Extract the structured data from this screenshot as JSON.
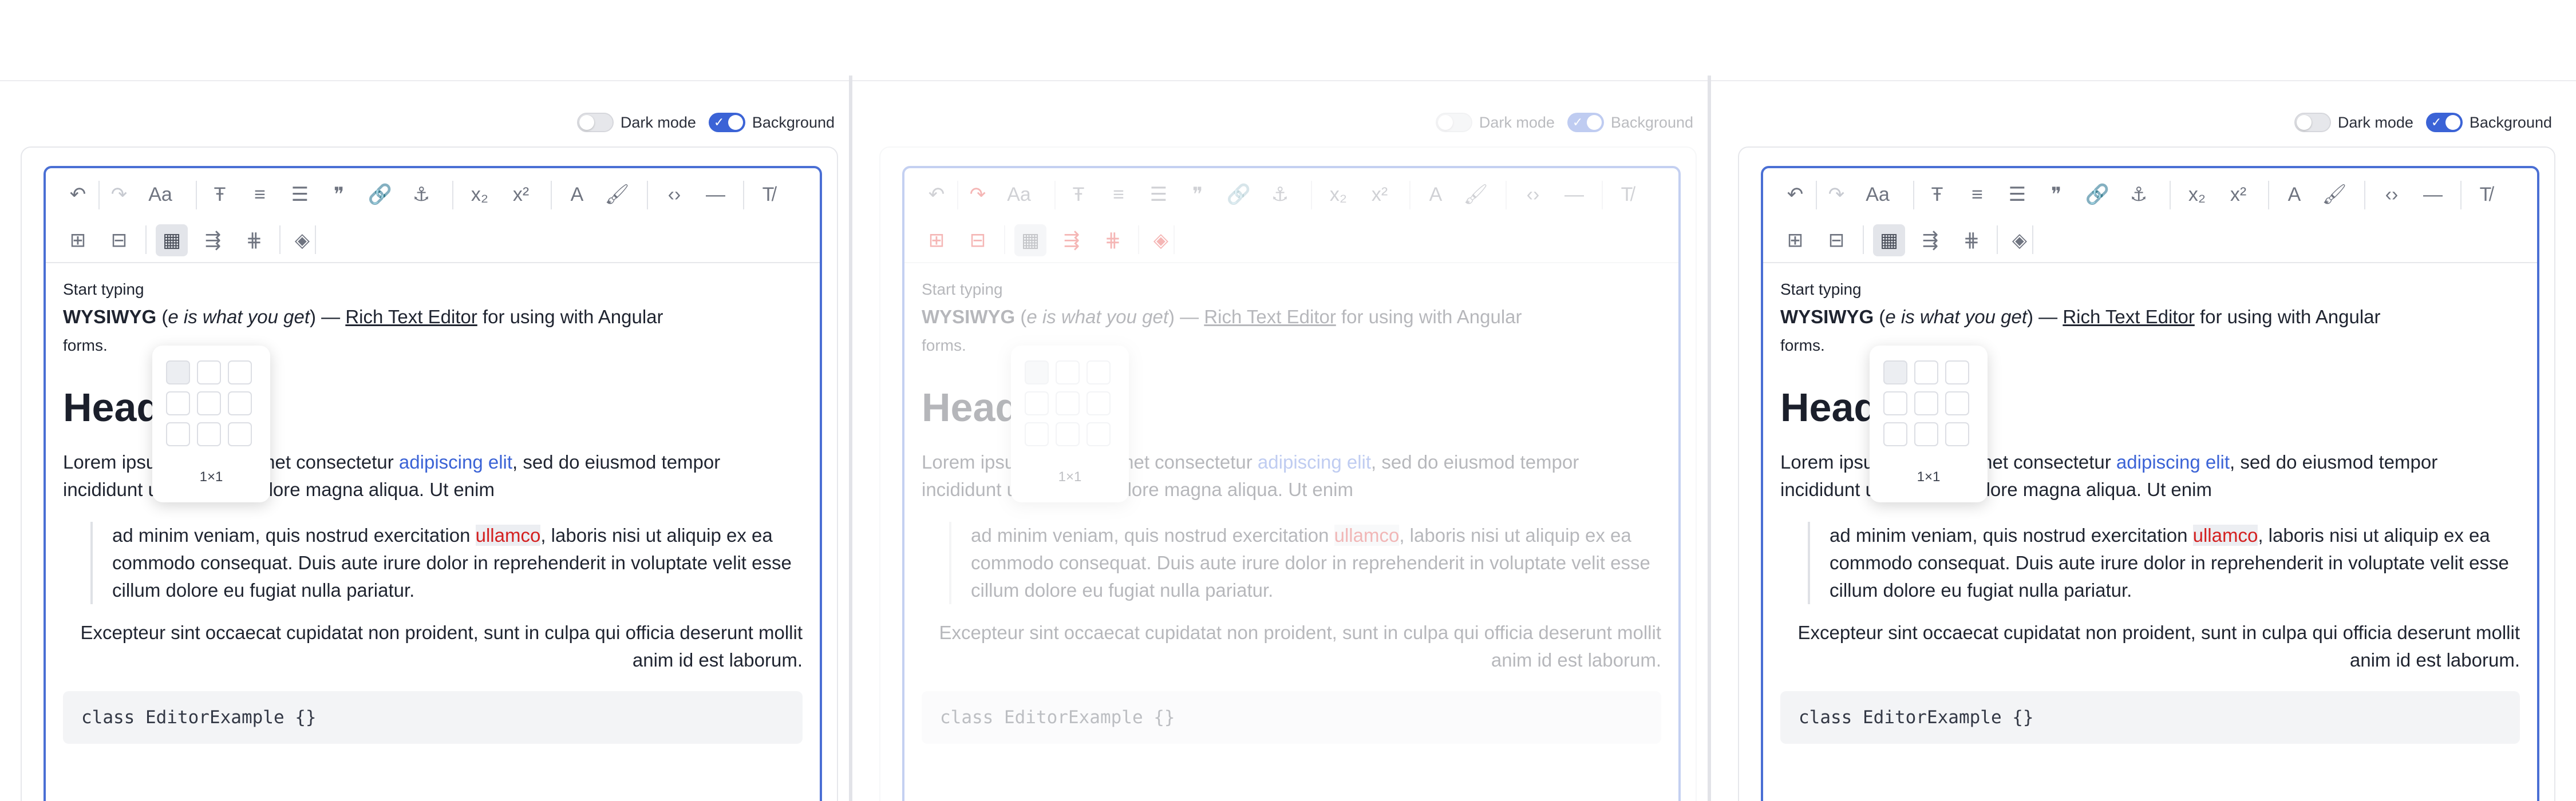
{
  "panels": [
    {
      "state": "normal",
      "toggles": {
        "dark_mode": "Dark mode",
        "dark_mode_on": false,
        "background": "Background",
        "background_on": true
      },
      "popup_visible": true
    },
    {
      "state": "faded",
      "toggles": {
        "dark_mode": "Dark mode",
        "dark_mode_on": false,
        "background": "Background",
        "background_on": true
      },
      "popup_visible": true
    },
    {
      "state": "normal",
      "toggles": {
        "dark_mode": "Dark mode",
        "dark_mode_on": false,
        "background": "Background",
        "background_on": true
      },
      "popup_visible": true
    }
  ],
  "toolbar": {
    "row1": [
      "undo-icon",
      "redo-icon",
      "text-case-icon",
      "text-style-icon",
      "align-icon",
      "bullet-list-icon",
      "blockquote-icon",
      "link-icon",
      "anchor-icon",
      "subscript-icon",
      "superscript-icon",
      "text-color-icon",
      "highlight-icon",
      "code-icon",
      "horizontal-rule-icon",
      "clear-format-icon"
    ],
    "row2": [
      "add-row-icon",
      "remove-row-icon",
      "table-icon",
      "insert-column-icon",
      "insert-table-rows-icon",
      "cell-fill-icon"
    ]
  },
  "content": {
    "start_text": "Start typing",
    "wysiwyg": "WYSIWYG",
    "wysiwyg_tail": "e is what you get",
    "dash_text": ") — ",
    "rte_link": "Rich Text Editor",
    "after_link": " for using with Angular",
    "forms": "forms.",
    "heading": "Heading",
    "lorem_start": "Lorem ipsum dolor sit amet consectetur ",
    "lorem_link": "adipiscing elit",
    "lorem_end": ", sed do eiusmod tempor incididunt ut labore et dolore magna aliqua. Ut enim",
    "quote_start": "ad minim veniam, quis nostrud exercitation ",
    "quote_mark": "ullamco",
    "quote_end": ", laboris nisi ut aliquip ex ea commodo consequat. Duis aute irure dolor in reprehenderit in voluptate velit esse cillum dolore eu fugiat nulla pariatur.",
    "excepteur": "Excepteur sint occaecat cupidatat non proident, sunt in culpa qui officia deserunt mollit anim id est laborum.",
    "code": "class EditorExample {}"
  },
  "table_picker": {
    "rows": 3,
    "cols": 3,
    "selected_rows": 1,
    "selected_cols": 1,
    "size_label": "1×1"
  },
  "colors": {
    "accent": "#3b63d6",
    "danger": "#e3201b",
    "border": "#4a6fd4"
  }
}
